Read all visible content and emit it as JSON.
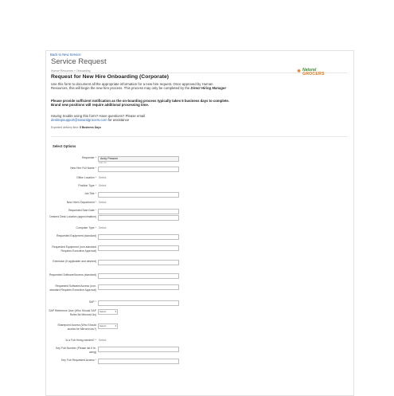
{
  "back_link": "Back to New Service",
  "page_title": "Service Request",
  "breadcrumb": "Human Resources » Onboarding",
  "form_title": "Request for New Hire Onboarding (Corporate)",
  "logo": {
    "line1": "Natural",
    "line2": "GROCERS"
  },
  "intro_pre": "Use this form to document all the appropriate information for a new hire request. Once approved by Human Resources, this will begin the new hire process. This process may only be completed by the ",
  "intro_em": "Direct Hiring Manager",
  "note": "Please provide sufficient notification as the on-boarding process typically takes 5 business days to complete. Brand new positions will require additional processing time.",
  "trouble_line1": "Having trouble using this form? Have questions? Please email",
  "trouble_email": "desktopsupport@naturalgrocers.com",
  "trouble_suffix": " for assistance",
  "delivery_label": "Expected delivery time: ",
  "delivery_value": "5 Business Days",
  "section_title": "Select Options",
  "fields": [
    {
      "label": "Requester",
      "value": "Andy Pessner",
      "sub": "Add CC"
    },
    {
      "label": "New Hire Full Name",
      "value": ""
    },
    {
      "label": "Office Location",
      "value": "Select"
    },
    {
      "label": "Position Type",
      "value": "Select"
    },
    {
      "label": "Job Title",
      "value": ""
    },
    {
      "label": "New Hire's Department",
      "value": "Select"
    },
    {
      "label": "Requested Start Date",
      "value": ""
    },
    {
      "label": "Desired Desk Location (approximation)",
      "value": ""
    },
    {
      "label": "Computer Type",
      "value": "Select"
    },
    {
      "label": "Requested Equipment (standard)",
      "value": ""
    },
    {
      "label": "Requested Equipment (non-standard Requires Executive Approval)",
      "value": ""
    },
    {
      "label": "Extension (if applicable and desired)",
      "value": ""
    },
    {
      "label": "Requested Software/Access (standard)",
      "value": ""
    },
    {
      "label": "Requested Software/Access (non-standard Requires Executive Approval)",
      "value": ""
    },
    {
      "label": "SAP",
      "value": ""
    },
    {
      "label": "SAP Reference User (Who Should SAP Roles Be Mirrored As)",
      "value": "Select"
    },
    {
      "label": "Sharepoint Access (Who Should access be Mirrored as?)",
      "value": "Select"
    },
    {
      "label": "Is a Fob Hiring needed?",
      "value": "Select"
    },
    {
      "label": "Key Fob Number (Please list if re-using)",
      "value": ""
    },
    {
      "label": "Key Fob Requested Access",
      "value": ""
    }
  ]
}
